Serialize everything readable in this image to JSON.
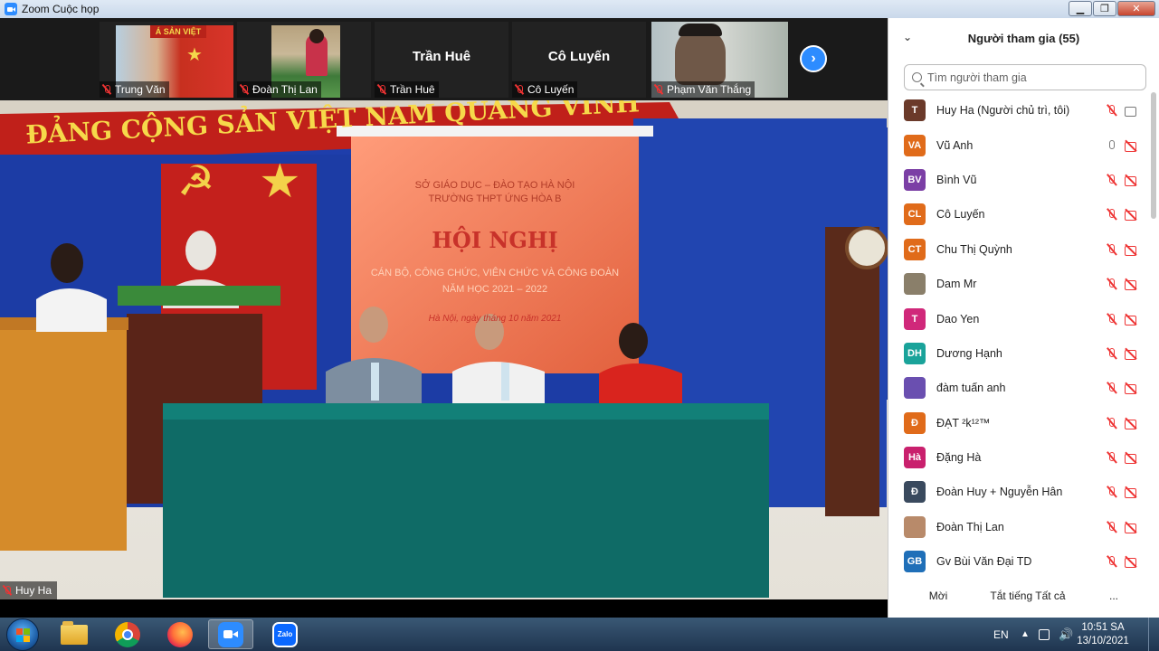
{
  "window": {
    "title": "Zoom Cuộc họp"
  },
  "thumbnails": [
    {
      "name": "Trung Văn",
      "big_name": ""
    },
    {
      "name": "Đoàn Thị Lan",
      "big_name": ""
    },
    {
      "name": "Trần Huê",
      "big_name": "Trần Huê"
    },
    {
      "name": "Cô Luyến",
      "big_name": "Cô Luyến"
    },
    {
      "name": "Phạm Văn Thắng",
      "big_name": ""
    }
  ],
  "main_video": {
    "speaker": "Huy Ha",
    "banner_text": "ĐẢNG CỘNG SẢN VIỆT NAM QUANG VINH",
    "screen_line1": "SỞ GIÁO DỤC – ĐÀO TẠO HÀ NỘI",
    "screen_line2": "TRƯỜNG THPT ỨNG HÒA B",
    "screen_title": "HỘI NGHỊ",
    "screen_line3": "CÁN BỘ, CÔNG CHỨC, VIÊN CHỨC VÀ CÔNG ĐOÀN",
    "screen_line4": "NĂM HỌC 2021 – 2022",
    "screen_line5": "Hà Nội, ngày      tháng 10 năm 2021"
  },
  "participants_panel": {
    "title": "Người tham gia (55)",
    "search_placeholder": "Tìm người tham gia",
    "participants": [
      {
        "initials": "T",
        "name": "Huy Ha (Người chủ trì, tôi)",
        "color": "#6b3a2a",
        "mic": "muted",
        "video": "on"
      },
      {
        "initials": "VA",
        "name": "Vũ Anh",
        "color": "#e06b1a",
        "mic": "on",
        "video": "off"
      },
      {
        "initials": "BV",
        "name": "Bình Vũ",
        "color": "#7b3fa5",
        "mic": "muted",
        "video": "off"
      },
      {
        "initials": "CL",
        "name": "Cô Luyến",
        "color": "#e06b1a",
        "mic": "muted",
        "video": "off"
      },
      {
        "initials": "CT",
        "name": "Chu Thị Quỳnh",
        "color": "#e06b1a",
        "mic": "muted",
        "video": "off"
      },
      {
        "initials": "",
        "name": "Dam Mr",
        "color": "#8a7f6a",
        "mic": "muted",
        "video": "off"
      },
      {
        "initials": "T",
        "name": "Dao Yen",
        "color": "#d0287a",
        "mic": "muted",
        "video": "off"
      },
      {
        "initials": "DH",
        "name": "Dương Hạnh",
        "color": "#1aa39a",
        "mic": "muted",
        "video": "off"
      },
      {
        "initials": "",
        "name": "đàm tuấn anh",
        "color": "#6a4fb0",
        "mic": "muted",
        "video": "off"
      },
      {
        "initials": "Đ",
        "name": "ĐẠT ²k¹²™",
        "color": "#e06b1a",
        "mic": "muted",
        "video": "off"
      },
      {
        "initials": "Hà",
        "name": "Đặng Hà",
        "color": "#c9206d",
        "mic": "muted",
        "video": "off"
      },
      {
        "initials": "Đ",
        "name": "Đoàn Huy + Nguyễn Hân",
        "color": "#3a4a5e",
        "mic": "muted",
        "video": "off"
      },
      {
        "initials": "",
        "name": "Đoàn Thị Lan",
        "color": "#b88a6a",
        "mic": "muted",
        "video": "off"
      },
      {
        "initials": "GB",
        "name": "Gv Bùi Văn Đại TD",
        "color": "#1f6fb8",
        "mic": "muted",
        "video": "off"
      }
    ],
    "footer": {
      "invite": "Mời",
      "mute_all": "Tắt tiếng Tất cả",
      "more": "..."
    }
  },
  "taskbar": {
    "apps": [
      "file-explorer",
      "chrome",
      "firefox",
      "zoom",
      "zalo"
    ],
    "zalo_label": "Zalo",
    "language": "EN",
    "time": "10:51 SA",
    "date": "13/10/2021"
  }
}
